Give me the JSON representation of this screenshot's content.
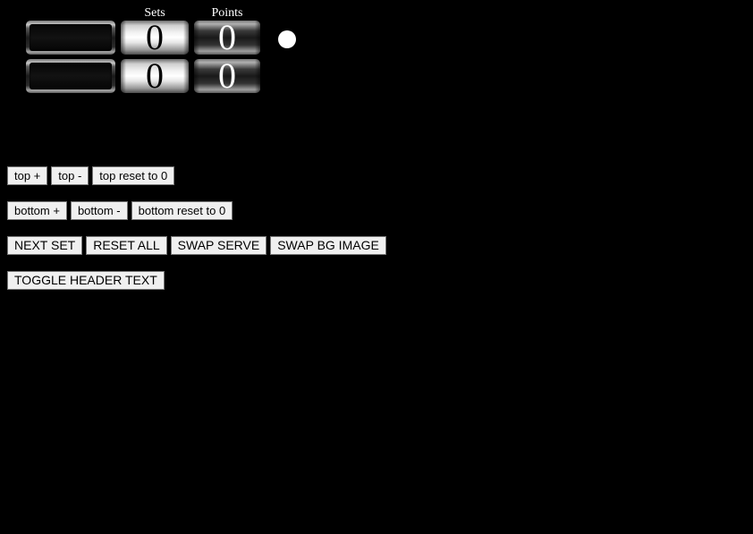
{
  "headers": {
    "sets": "Sets",
    "points": "Points"
  },
  "teams": {
    "top": {
      "name": "",
      "sets": "0",
      "points": "0"
    },
    "bottom": {
      "name": "",
      "sets": "0",
      "points": "0"
    }
  },
  "serve": {
    "indicator_color": "#ffffff",
    "serving": "top"
  },
  "buttons": {
    "top_plus": "top +",
    "top_minus": "top -",
    "top_reset": "top reset to 0",
    "bottom_plus": "bottom +",
    "bottom_minus": "bottom -",
    "bottom_reset": "bottom reset to 0",
    "next_set": "NEXT SET",
    "reset_all": "RESET ALL",
    "swap_serve": "SWAP SERVE",
    "swap_bg_image": "SWAP BG IMAGE",
    "toggle_header_text": "TOGGLE HEADER TEXT"
  },
  "colors": {
    "background": "#000000",
    "header_text": "#ffffff",
    "sets_digit": "#000000",
    "points_digit": "#ffffff"
  }
}
